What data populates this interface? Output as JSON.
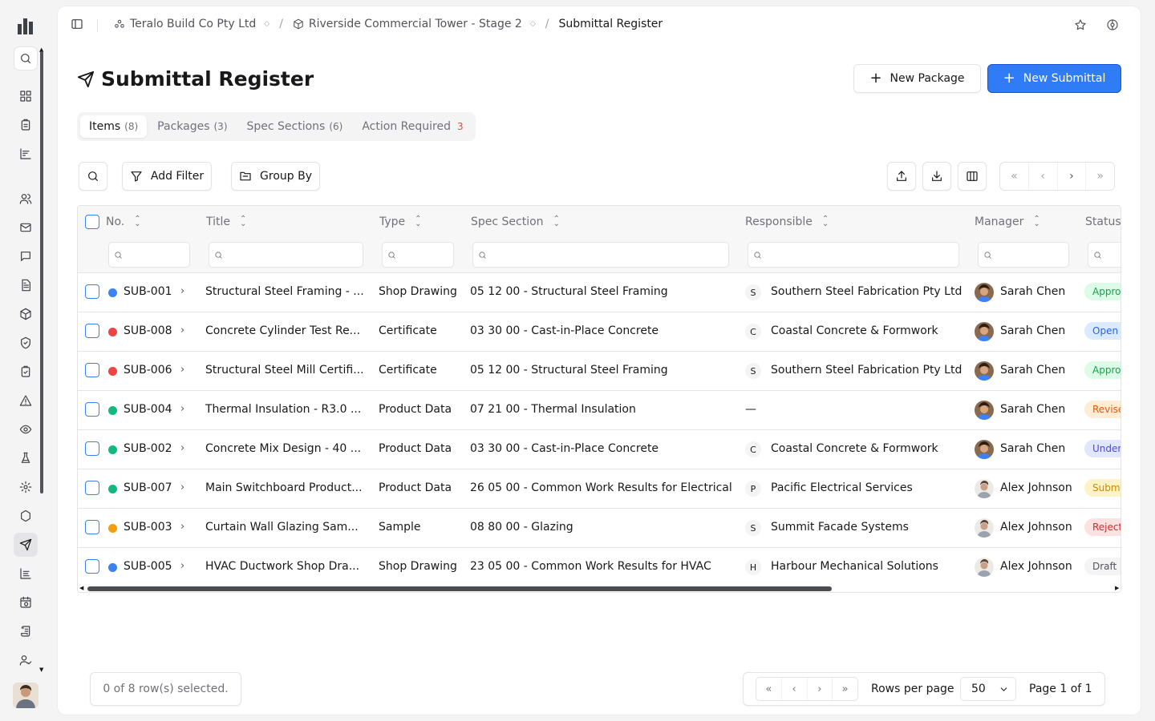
{
  "breadcrumb": {
    "org": "Teralo Build Co Pty Ltd",
    "project": "Riverside Commercial Tower - Stage 2",
    "page": "Submittal Register"
  },
  "page": {
    "title": "Submittal Register"
  },
  "actions": {
    "new_package": "New Package",
    "new_submittal": "New Submittal"
  },
  "tabs": [
    {
      "label": "Items",
      "count": "(8)"
    },
    {
      "label": "Packages",
      "count": "(3)"
    },
    {
      "label": "Spec Sections",
      "count": "(6)"
    },
    {
      "label": "Action Required",
      "count": "3"
    }
  ],
  "toolbar": {
    "add_filter": "Add Filter",
    "group_by": "Group By"
  },
  "columns": [
    "No.",
    "Title",
    "Type",
    "Spec Section",
    "Responsible",
    "Manager",
    "Status"
  ],
  "rows": [
    {
      "no": "SUB-001",
      "dot": "#3b82f6",
      "title": "Structural Steel Framing - ...",
      "type": "Shop Drawing",
      "spec": "05 12 00 - Structural Steel Framing",
      "initial": "S",
      "responsible": "Southern Steel Fabrication Pty Ltd",
      "manager": "Sarah Chen",
      "status": "Approved",
      "status_bg": "#dcfce7",
      "status_fg": "#16a34a"
    },
    {
      "no": "SUB-008",
      "dot": "#ef4444",
      "title": "Concrete Cylinder Test Re...",
      "type": "Certificate",
      "spec": "03 30 00 - Cast-in-Place Concrete",
      "initial": "C",
      "responsible": "Coastal Concrete & Formwork",
      "manager": "Sarah Chen",
      "status": "Open",
      "status_bg": "#dbeafe",
      "status_fg": "#2563eb"
    },
    {
      "no": "SUB-006",
      "dot": "#ef4444",
      "title": "Structural Steel Mill Certifi...",
      "type": "Certificate",
      "spec": "05 12 00 - Structural Steel Framing",
      "initial": "S",
      "responsible": "Southern Steel Fabrication Pty Ltd",
      "manager": "Sarah Chen",
      "status": "Approved",
      "status_bg": "#dcfce7",
      "status_fg": "#16a34a"
    },
    {
      "no": "SUB-004",
      "dot": "#10b981",
      "title": "Thermal Insulation - R3.0 ...",
      "type": "Product Data",
      "spec": "07 21 00 - Thermal Insulation",
      "initial": "",
      "responsible": "—",
      "manager": "Sarah Chen",
      "status": "Revise",
      "status_bg": "#ffedd5",
      "status_fg": "#ea580c"
    },
    {
      "no": "SUB-002",
      "dot": "#10b981",
      "title": "Concrete Mix Design - 40 ...",
      "type": "Product Data",
      "spec": "03 30 00 - Cast-in-Place Concrete",
      "initial": "C",
      "responsible": "Coastal Concrete & Formwork",
      "manager": "Sarah Chen",
      "status": "Under",
      "status_bg": "#e0e7ff",
      "status_fg": "#4f46e5"
    },
    {
      "no": "SUB-007",
      "dot": "#10b981",
      "title": "Main Switchboard Product...",
      "type": "Product Data",
      "spec": "26 05 00 - Common Work Results for Electrical",
      "initial": "P",
      "responsible": "Pacific Electrical Services",
      "manager": "Alex Johnson",
      "status": "Subm",
      "status_bg": "#fef3c7",
      "status_fg": "#ca8a04"
    },
    {
      "no": "SUB-003",
      "dot": "#f59e0b",
      "title": "Curtain Wall Glazing Sam...",
      "type": "Sample",
      "spec": "08 80 00 - Glazing",
      "initial": "S",
      "responsible": "Summit Facade Systems",
      "manager": "Alex Johnson",
      "status": "Reject",
      "status_bg": "#fee2e2",
      "status_fg": "#dc2626"
    },
    {
      "no": "SUB-005",
      "dot": "#3b82f6",
      "title": "HVAC Ductwork Shop Dra...",
      "type": "Shop Drawing",
      "spec": "23 05 00 - Common Work Results for HVAC",
      "initial": "H",
      "responsible": "Harbour Mechanical Solutions",
      "manager": "Alex Johnson",
      "status": "Draft",
      "status_bg": "#f4f4f5",
      "status_fg": "#52525b"
    }
  ],
  "footer": {
    "selection": "0 of 8 row(s) selected.",
    "rows_per_page_label": "Rows per page",
    "rows_per_page": "50",
    "page_info": "Page 1 of 1"
  },
  "icons": [
    "logo-icon",
    "search-icon",
    "dashboard-icon",
    "clipboard-icon",
    "chart-icon",
    "users-icon",
    "mail-icon",
    "message-icon",
    "document-icon",
    "package-icon",
    "shield-icon",
    "checklist-icon",
    "warning-icon",
    "eye-icon",
    "flask-icon",
    "gear-icon",
    "hexagon-icon",
    "send-icon",
    "list-icon",
    "calendar-clock-icon",
    "scroll-icon",
    "user-check-icon"
  ]
}
